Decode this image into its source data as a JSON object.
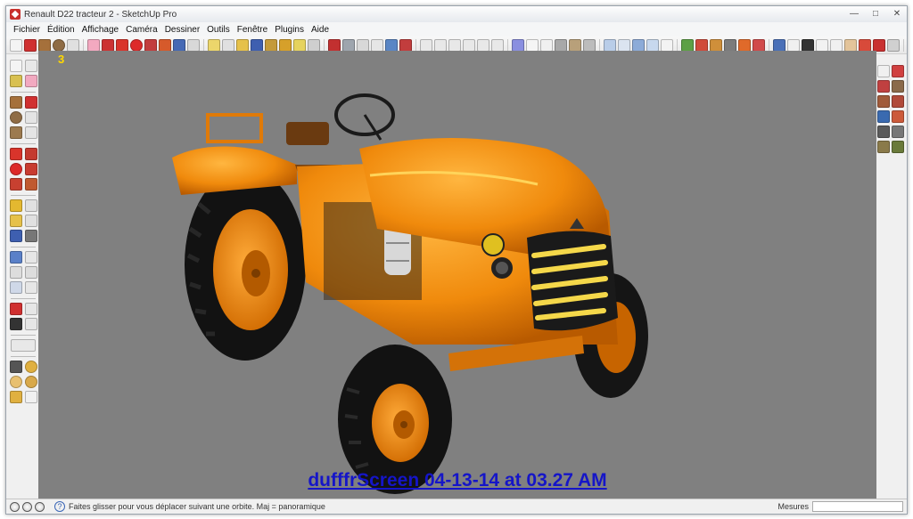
{
  "window": {
    "title": "Renault D22 tracteur 2 - SketchUp Pro"
  },
  "menu": {
    "items": [
      "Fichier",
      "Édition",
      "Affichage",
      "Caméra",
      "Dessiner",
      "Outils",
      "Fenêtre",
      "Plugins",
      "Aide"
    ]
  },
  "viewport": {
    "axis_label": "3",
    "background_color": "#808080",
    "watermark": "dufffrScreen 04-13-14 at 03.27 AM"
  },
  "status": {
    "hint": "Faites glisser pour vous déplacer suivant une orbite.  Maj = panoramique",
    "measure_label": "Mesures",
    "measure_value": ""
  },
  "colors": {
    "tractor_orange": "#f08a0c",
    "tire": "#141414",
    "grille_yellow": "#f5d84a",
    "watermark": "#1515c8"
  }
}
